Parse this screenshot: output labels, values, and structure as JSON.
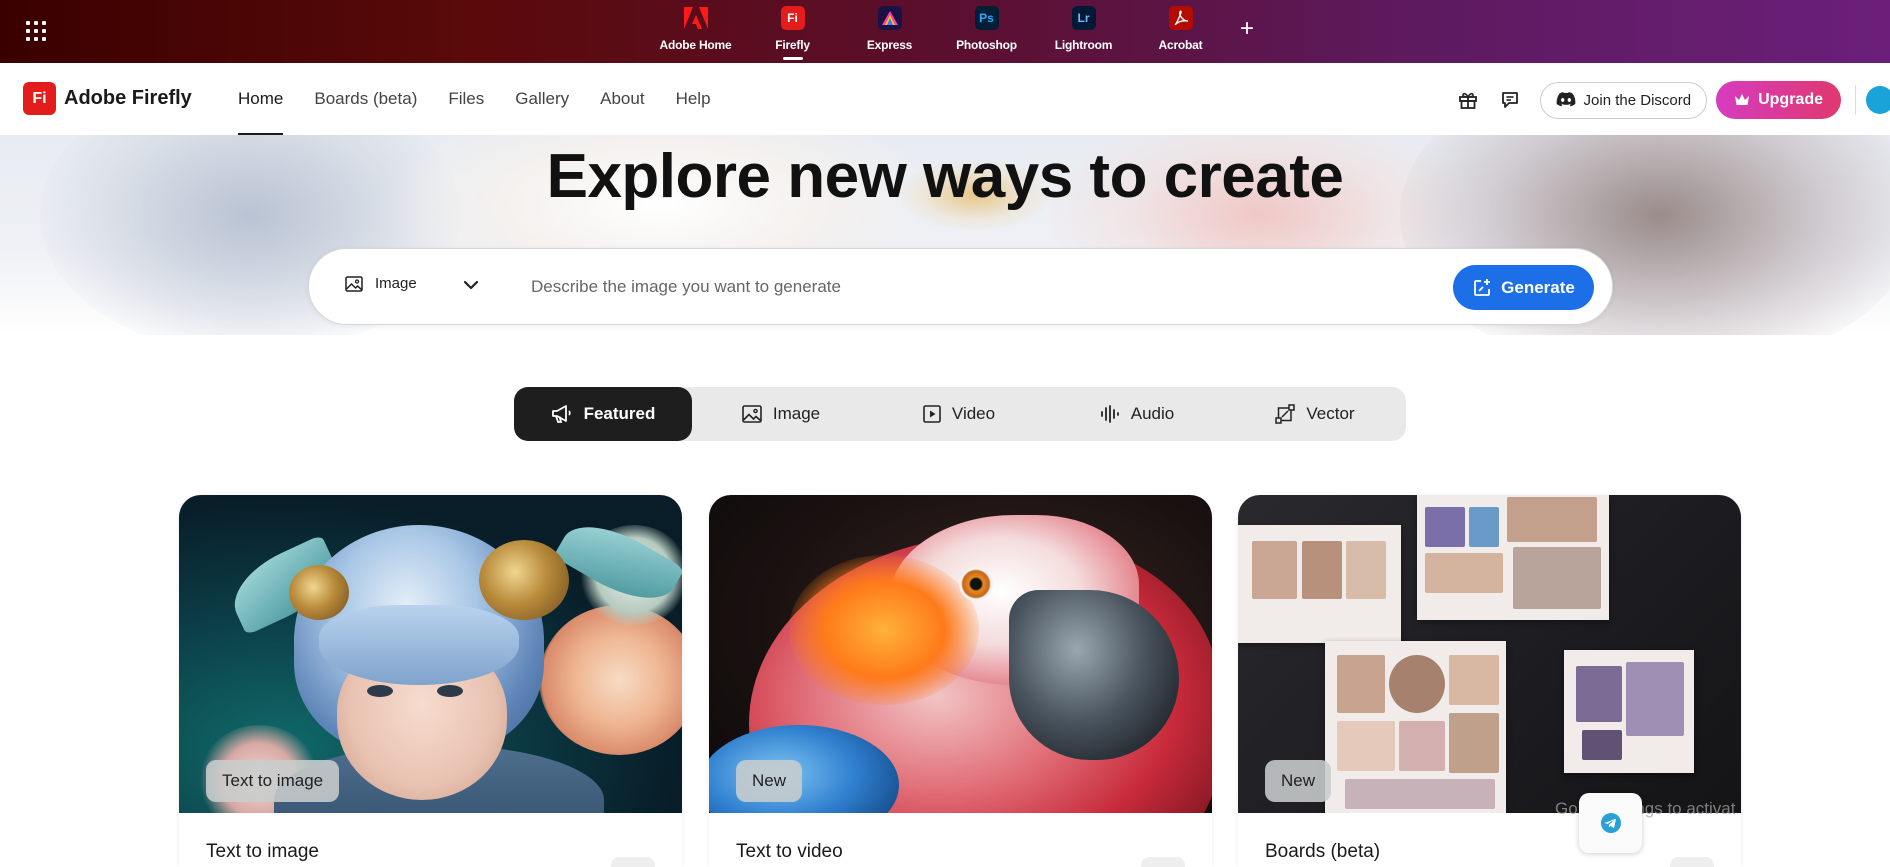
{
  "app_switcher": {
    "apps": [
      {
        "label": "Adobe Home",
        "icon": "adobe-logo-icon",
        "active": false
      },
      {
        "label": "Firefly",
        "icon": "firefly-app-icon",
        "glyph": "Fi",
        "active": true
      },
      {
        "label": "Express",
        "icon": "express-app-icon",
        "active": false
      },
      {
        "label": "Photoshop",
        "icon": "photoshop-app-icon",
        "glyph": "Ps",
        "active": false
      },
      {
        "label": "Lightroom",
        "icon": "lightroom-app-icon",
        "glyph": "Lr",
        "active": false
      },
      {
        "label": "Acrobat",
        "icon": "acrobat-app-icon",
        "active": false
      }
    ],
    "add_glyph": "+"
  },
  "nav": {
    "brand_glyph": "Fi",
    "brand_name": "Adobe Firefly",
    "items": [
      {
        "label": "Home",
        "active": true
      },
      {
        "label": "Boards (beta)",
        "active": false
      },
      {
        "label": "Files",
        "active": false
      },
      {
        "label": "Gallery",
        "active": false
      },
      {
        "label": "About",
        "active": false
      },
      {
        "label": "Help",
        "active": false
      }
    ],
    "discord_label": "Join the Discord",
    "upgrade_label": "Upgrade"
  },
  "hero": {
    "title": "Explore new ways to create"
  },
  "prompt": {
    "type_label": "Image",
    "placeholder": "Describe the image you want to generate",
    "value": "",
    "generate_label": "Generate"
  },
  "tabs": [
    {
      "label": "Featured",
      "icon": "megaphone-icon",
      "active": true
    },
    {
      "label": "Image",
      "icon": "image-icon",
      "active": false
    },
    {
      "label": "Video",
      "icon": "video-icon",
      "active": false
    },
    {
      "label": "Audio",
      "icon": "audio-wave-icon",
      "active": false
    },
    {
      "label": "Vector",
      "icon": "vector-icon",
      "active": false
    }
  ],
  "cards": [
    {
      "badge": "Text to image",
      "title": "Text to image"
    },
    {
      "badge": "New",
      "title": "Text to video"
    },
    {
      "badge": "New",
      "title": "Boards (beta)"
    }
  ],
  "overlay": {
    "watermark": "Go to Settings to activat"
  },
  "colors": {
    "accent_blue": "#1d6fe8",
    "firefly_red": "#e31c1c",
    "upgrade_gradient_start": "#d63cc0",
    "upgrade_gradient_end": "#e0386e",
    "active_tab_bg": "#1e1e1e"
  }
}
